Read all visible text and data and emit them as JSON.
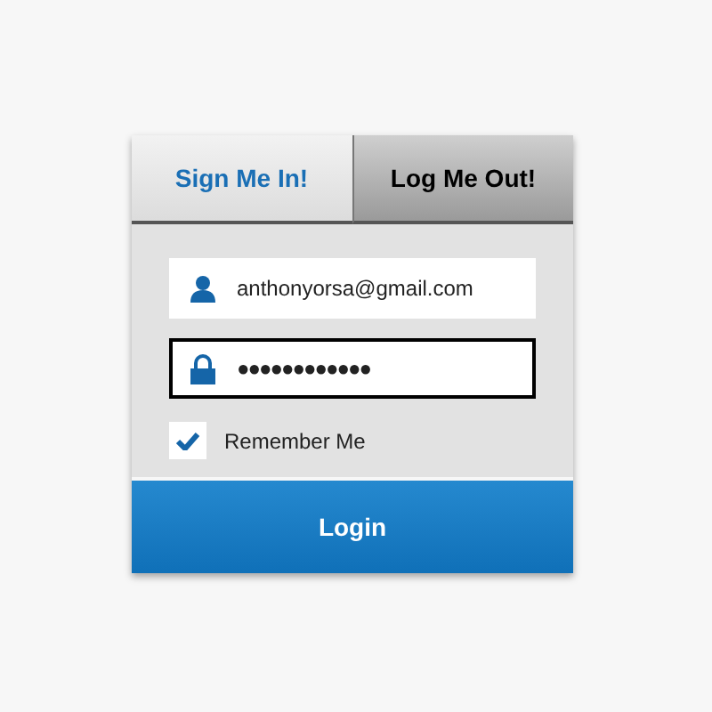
{
  "tabs": [
    {
      "label": "Sign Me In!",
      "selected": true
    },
    {
      "label": "Log Me Out!",
      "selected": false
    }
  ],
  "fields": [
    {
      "kind": "user",
      "value": "anthonyorsa@gmail.com",
      "focused": false
    },
    {
      "kind": "password",
      "value": "●●●●●●●●●●●●",
      "focused": true
    }
  ],
  "remember": {
    "label": "Remember Me",
    "checked": true
  },
  "login_button": {
    "label": "Login"
  }
}
